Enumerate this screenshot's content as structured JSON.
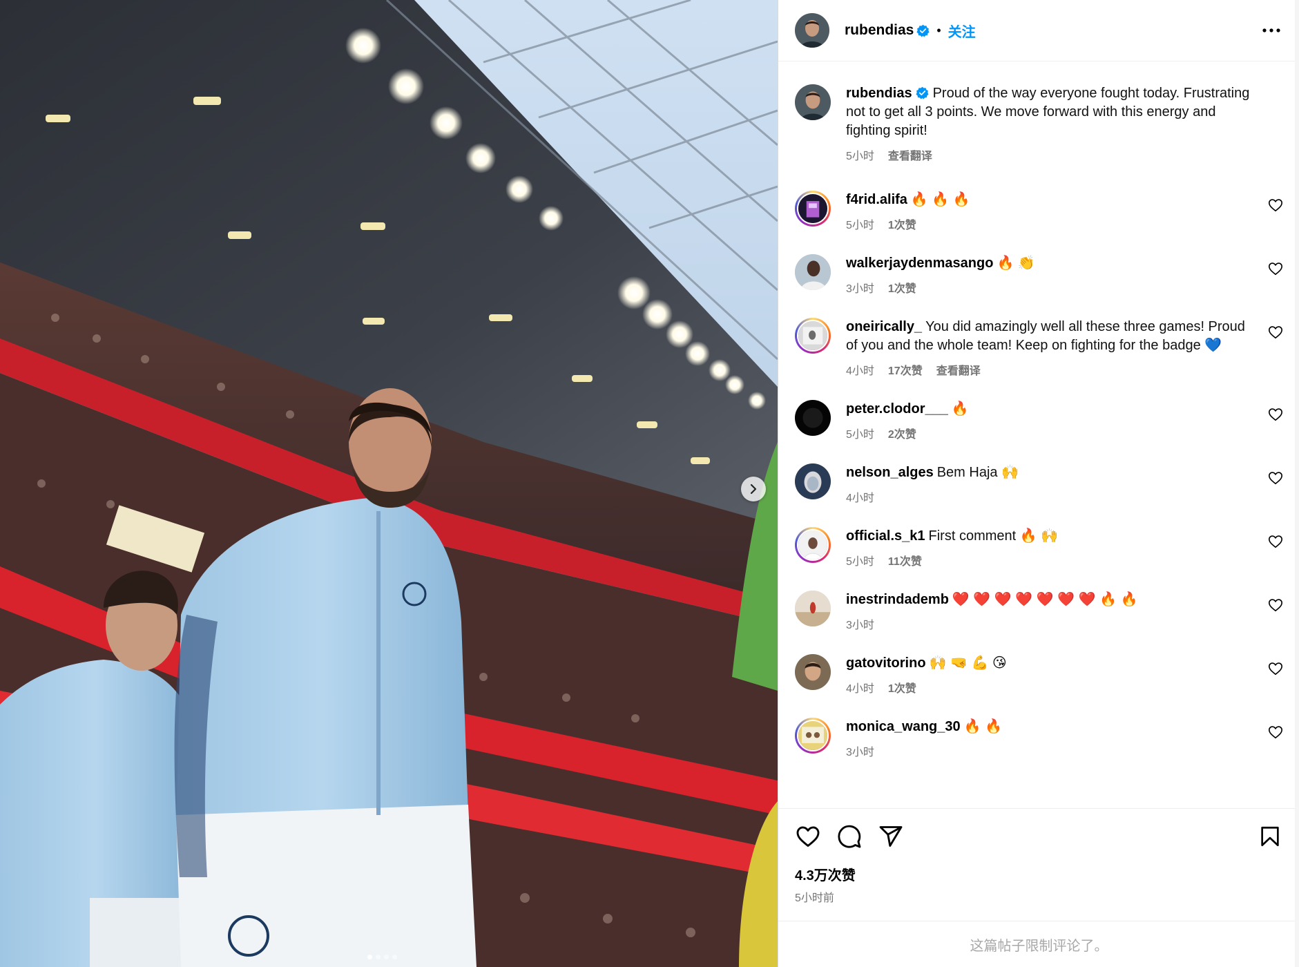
{
  "post": {
    "username": "rubendias",
    "follow_label": "关注",
    "dot": "•",
    "likes": "4.3万次赞",
    "time": "5小时前",
    "limited_notice": "这篇帖子限制评论了。",
    "carousel": {
      "count": 4,
      "active_index": 0
    }
  },
  "caption": {
    "username": "rubendias",
    "text": "Proud of the way everyone fought today. Frustrating not to get all 3 points. We move forward with this energy and fighting spirit!",
    "time": "5小时",
    "translate": "查看翻译"
  },
  "comments": [
    {
      "username": "f4rid.alifa",
      "text": "🔥 🔥 🔥",
      "time": "5小时",
      "likes": "1次赞",
      "translate": ""
    },
    {
      "username": "walkerjaydenmasango",
      "text": "🔥 👏",
      "time": "3小时",
      "likes": "1次赞",
      "translate": ""
    },
    {
      "username": "oneirically_",
      "text": "You did amazingly well all these three games! Proud of you and the whole team! Keep on fighting for the badge 💙",
      "time": "4小时",
      "likes": "17次赞",
      "translate": "查看翻译"
    },
    {
      "username": "peter.clodor___",
      "text": "🔥",
      "time": "5小时",
      "likes": "2次赞",
      "translate": ""
    },
    {
      "username": "nelson_alges",
      "text": "Bem Haja 🙌",
      "time": "4小时",
      "likes": "",
      "translate": ""
    },
    {
      "username": "official.s_k1",
      "text": "First comment 🔥 🙌",
      "time": "5小时",
      "likes": "11次赞",
      "translate": ""
    },
    {
      "username": "inestrindademb",
      "text": "❤️ ❤️ ❤️ ❤️ ❤️ ❤️ ❤️ 🔥 🔥",
      "time": "3小时",
      "likes": "",
      "translate": ""
    },
    {
      "username": "gatovitorino",
      "text": "🙌 🤜 💪 😘",
      "time": "4小时",
      "likes": "1次赞",
      "translate": ""
    },
    {
      "username": "monica_wang_30",
      "text": "🔥 🔥",
      "time": "3小时",
      "likes": "",
      "translate": ""
    }
  ],
  "icons": {
    "verified": "verified-badge-icon",
    "more": "more-options-icon",
    "like": "heart-icon",
    "comment": "comment-bubble-icon",
    "share": "paper-plane-icon",
    "save": "bookmark-icon",
    "next": "chevron-right-icon"
  },
  "colors": {
    "accent": "#0095f6",
    "verified": "#0095f6",
    "muted": "#737373"
  }
}
